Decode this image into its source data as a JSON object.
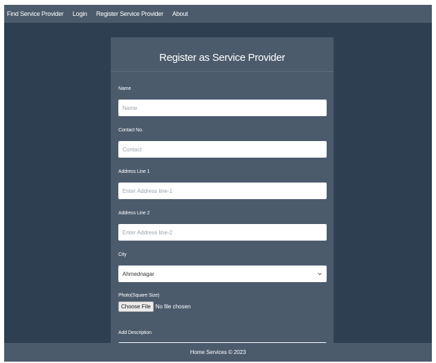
{
  "navbar": {
    "links": [
      {
        "label": "Find Service Provider"
      },
      {
        "label": "Login"
      },
      {
        "label": "Register Service Provider"
      },
      {
        "label": "About"
      }
    ]
  },
  "form": {
    "title": "Register as Service Provider",
    "name": {
      "label": "Name",
      "placeholder": "Name",
      "value": ""
    },
    "contact": {
      "label": "Contact No.",
      "placeholder": "Contact",
      "value": ""
    },
    "address1": {
      "label": "Address Line 1",
      "placeholder": "Enter Address line-1",
      "value": ""
    },
    "address2": {
      "label": "Address Line 2",
      "placeholder": "Enter Address line-2",
      "value": ""
    },
    "city": {
      "label": "City",
      "selected": "Ahmednagar"
    },
    "photo": {
      "label": "Photo(Square Size)",
      "button_label": "Choose File",
      "status": "No file chosen"
    },
    "description": {
      "label": "Add Description"
    }
  },
  "footer": {
    "text": "Home Services © 2023"
  },
  "colors": {
    "page_background": "#2e3f51",
    "panel": "#4b5b6c",
    "text": "#ffffff"
  },
  "icons": {
    "city_select": "chevron-down-icon"
  }
}
